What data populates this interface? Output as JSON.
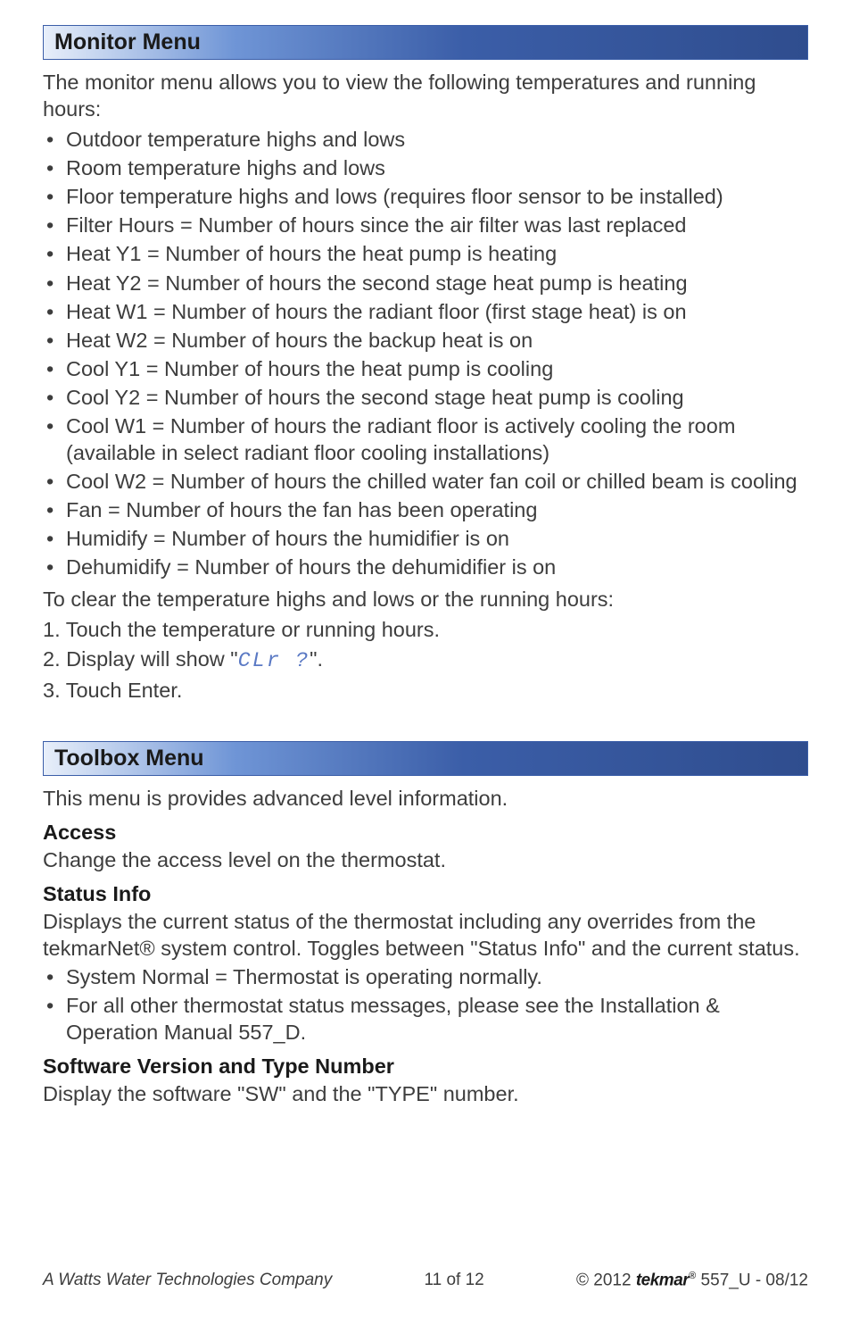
{
  "sections": {
    "monitor": {
      "title": "Monitor Menu",
      "intro": "The monitor menu allows you to view the following temperatures and running hours:",
      "bullets": [
        "Outdoor temperature highs and lows",
        "Room temperature highs and lows",
        "Floor temperature highs and lows (requires floor sensor to be installed)",
        "Filter Hours = Number of hours since the air filter was last replaced",
        "Heat Y1 = Number of hours the heat pump is heating",
        "Heat Y2 = Number of hours the second stage heat pump is heating",
        "Heat W1 = Number of hours the radiant floor (first stage heat) is on",
        "Heat W2 = Number of hours the backup heat is on",
        "Cool Y1 = Number of hours the heat pump is cooling",
        "Cool Y2 = Number of hours the second stage heat pump is cooling",
        "Cool W1 = Number of hours the radiant floor is actively cooling the room (available in select radiant floor cooling installations)",
        "Cool W2 = Number of hours the chilled water fan coil or chilled beam is cooling",
        "Fan = Number of hours the fan has been operating",
        "Humidify = Number of hours the humidifier is on",
        "Dehumidify = Number of hours the dehumidifier is on"
      ],
      "clear_intro": "To clear the temperature highs and lows or the running hours:",
      "steps": {
        "s1": "1. Touch the temperature or running hours.",
        "s2a": "2. Display will show \"",
        "s2_segment": "CLr ?",
        "s2b": "\".",
        "s3": "3. Touch Enter."
      }
    },
    "toolbox": {
      "title": "Toolbox Menu",
      "intro": "This menu is provides advanced level information.",
      "access_head": "Access",
      "access_body": "Change the access level on the thermostat.",
      "status_head": "Status Info",
      "status_body": "Displays the current status of the thermostat including any overrides from the tekmarNet® system control. Toggles between \"Status Info\" and the current status.",
      "status_bullets": [
        "System Normal = Thermostat is operating normally.",
        "For all other thermostat status messages, please see the Installation & Operation Manual 557_D."
      ],
      "sw_head": "Software Version and Type Number",
      "sw_body": "Display the software \"SW\"  and the \"TYPE\" number."
    }
  },
  "footer": {
    "left": "A Watts Water Technologies Company",
    "center": "11 of 12",
    "right_prefix": "© 2012 ",
    "brand": "tekmar",
    "reg": "®",
    "right_suffix": " 557_U - 08/12"
  }
}
